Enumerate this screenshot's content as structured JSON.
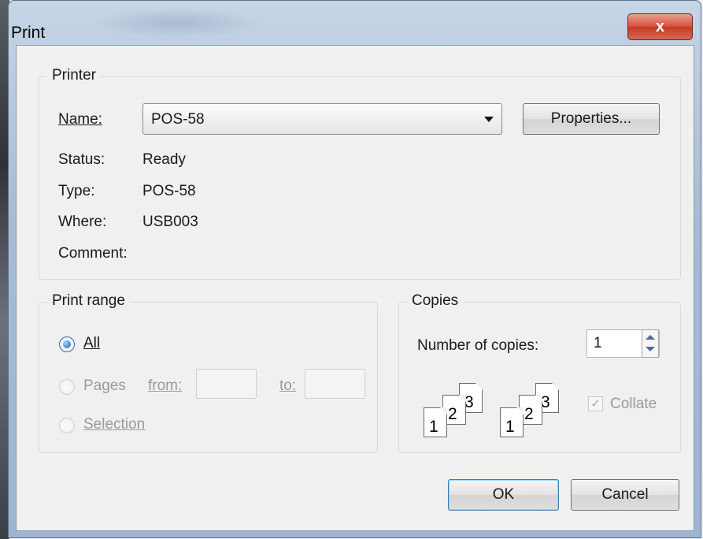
{
  "window": {
    "title": "Print",
    "close_glyph": "x"
  },
  "printer": {
    "group_label": "Printer",
    "name_label": "Name:",
    "name_value": "POS-58",
    "properties_button": "Properties...",
    "status_label": "Status:",
    "status_value": "Ready",
    "type_label": "Type:",
    "type_value": "POS-58",
    "where_label": "Where:",
    "where_value": "USB003",
    "comment_label": "Comment:"
  },
  "print_range": {
    "group_label": "Print range",
    "all_label": "All",
    "pages_label": "Pages",
    "from_label": "from:",
    "from_value": "",
    "to_label": "to:",
    "to_value": "",
    "selection_label": "Selection",
    "selected": "All"
  },
  "copies": {
    "group_label": "Copies",
    "number_label": "Number of copies:",
    "number_value": "1",
    "collate_label": "Collate",
    "collate_checked": true,
    "pages_illustration": [
      "1",
      "2",
      "3"
    ]
  },
  "footer": {
    "ok_button": "OK",
    "cancel_button": "Cancel"
  },
  "colors": {
    "close_button": "#d7513c",
    "default_button_border": "#3c7fb1"
  },
  "icons": [
    "close-icon",
    "chevron-down-icon",
    "radio-icon",
    "spinner-icon",
    "checkbox-icon",
    "collate-pages-icon"
  ]
}
